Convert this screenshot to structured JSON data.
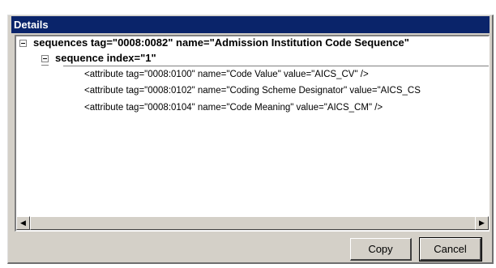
{
  "dialog": {
    "title": "Details",
    "tree": {
      "root_label": "sequences tag=\"0008:0082\" name=\"Admission Institution Code Sequence\"",
      "child_label": "sequence index=\"1\"",
      "attributes": [
        "<attribute tag=\"0008:0100\" name=\"Code Value\" value=\"AICS_CV\" />",
        "<attribute tag=\"0008:0102\" name=\"Coding Scheme Designator\" value=\"AICS_CS",
        "<attribute tag=\"0008:0104\" name=\"Code Meaning\" value=\"AICS_CM\" />"
      ]
    },
    "buttons": {
      "copy_label": "Copy",
      "cancel_label": "Cancel"
    }
  }
}
